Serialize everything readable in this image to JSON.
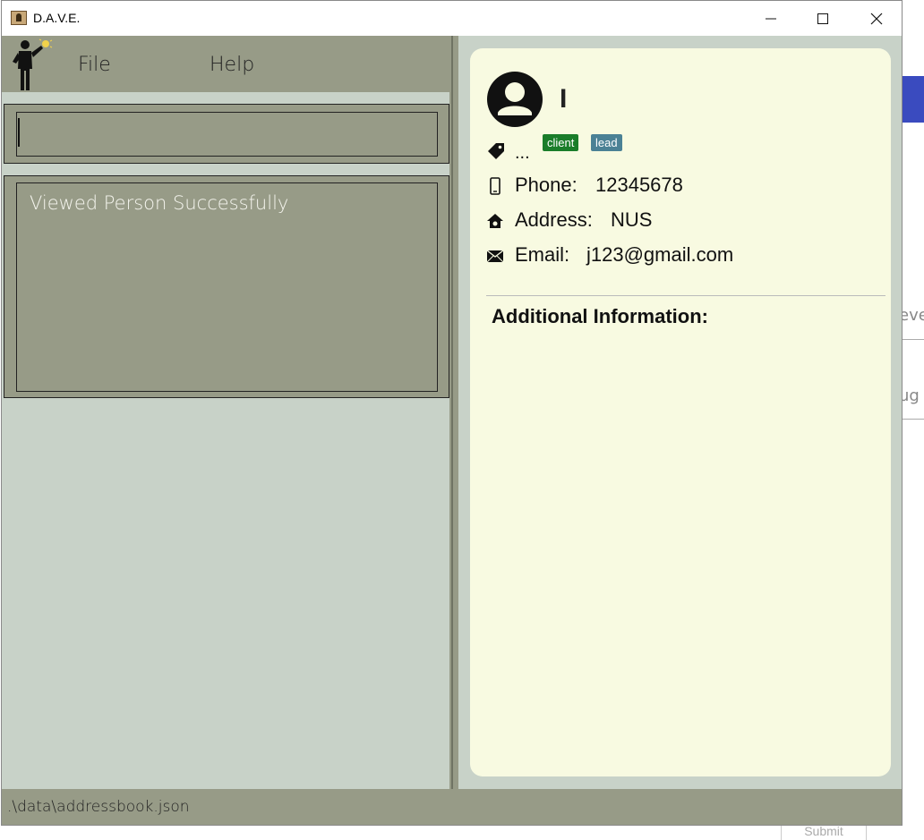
{
  "window": {
    "title": "D.A.V.E."
  },
  "menu": {
    "file": "File",
    "help": "Help"
  },
  "command": {
    "value": ""
  },
  "result": {
    "message": "Viewed Person Successfully"
  },
  "person": {
    "name": "I",
    "tags_overflow": "...",
    "tags": [
      {
        "label": "client",
        "color": "#1a7d2a"
      },
      {
        "label": "lead",
        "color": "#4b8195"
      }
    ],
    "phone_label": "Phone:",
    "phone": "12345678",
    "address_label": "Address:",
    "address": "NUS",
    "email_label": "Email:",
    "email": "j123@gmail.com",
    "additional_title": "Additional Information:"
  },
  "status": {
    "path": ".\\data\\addressbook.json"
  },
  "background": {
    "text1": "eve",
    "text2": "ug",
    "submit": "Submit"
  },
  "colors": {
    "panel": "#979b87",
    "card": "#f8fae1",
    "bg": "#c8d2c8"
  }
}
